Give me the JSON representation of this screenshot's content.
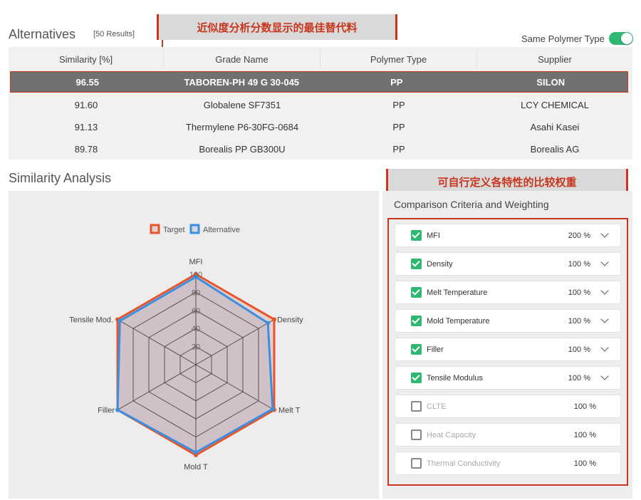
{
  "alternatives": {
    "title": "Alternatives",
    "count": "[50 Results]",
    "toggle_label": "Same Polymer Type",
    "columns": [
      "Similarity [%]",
      "Grade Name",
      "Polymer Type",
      "Supplier"
    ],
    "rows": [
      {
        "similarity": "96.55",
        "grade": "TABOREN-PH 49 G 30-045",
        "polymer": "PP",
        "supplier": "SILON"
      },
      {
        "similarity": "91.60",
        "grade": "Globalene SF7351",
        "polymer": "PP",
        "supplier": "LCY CHEMICAL"
      },
      {
        "similarity": "91.13",
        "grade": "Thermylene P6-30FG-0684",
        "polymer": "PP",
        "supplier": "Asahi Kasei"
      },
      {
        "similarity": "89.78",
        "grade": "Borealis PP GB300U",
        "polymer": "PP",
        "supplier": "Borealis AG"
      }
    ]
  },
  "callouts": {
    "top": "近似度分析分数显示的最佳替代料",
    "right": "可自行定义各特性的比较权重"
  },
  "similarity": {
    "title": "Similarity Analysis"
  },
  "colors": {
    "target": "#e8542a",
    "alternative": "#3b8fe0",
    "accent_red": "#c8361d",
    "toggle_green": "#2eb872"
  },
  "chart_data": {
    "type": "radar",
    "axes": [
      "MFI",
      "Density",
      "Melt T",
      "Mold T",
      "Filler",
      "Tensile Mod."
    ],
    "ticks": [
      "20",
      "40",
      "60",
      "80",
      "100"
    ],
    "rmax": 100,
    "legend": [
      "Target",
      "Alternative"
    ],
    "series": [
      {
        "name": "Target",
        "values": [
          100,
          100,
          100,
          100,
          100,
          100
        ]
      },
      {
        "name": "Alternative",
        "values": [
          97,
          92,
          98,
          97,
          100,
          97
        ]
      }
    ]
  },
  "criteria": {
    "title": "Comparison Criteria and Weighting",
    "items": [
      {
        "name": "MFI",
        "weight": "200 %",
        "checked": true
      },
      {
        "name": "Density",
        "weight": "100 %",
        "checked": true
      },
      {
        "name": "Melt Temperature",
        "weight": "100 %",
        "checked": true
      },
      {
        "name": "Mold Temperature",
        "weight": "100 %",
        "checked": true
      },
      {
        "name": "Filler",
        "weight": "100 %",
        "checked": true
      },
      {
        "name": "Tensile Modulus",
        "weight": "100 %",
        "checked": true
      },
      {
        "name": "CLTE",
        "weight": "100 %",
        "checked": false
      },
      {
        "name": "Heat Capacity",
        "weight": "100 %",
        "checked": false
      },
      {
        "name": "Thermal Conductivity",
        "weight": "100 %",
        "checked": false
      }
    ]
  }
}
